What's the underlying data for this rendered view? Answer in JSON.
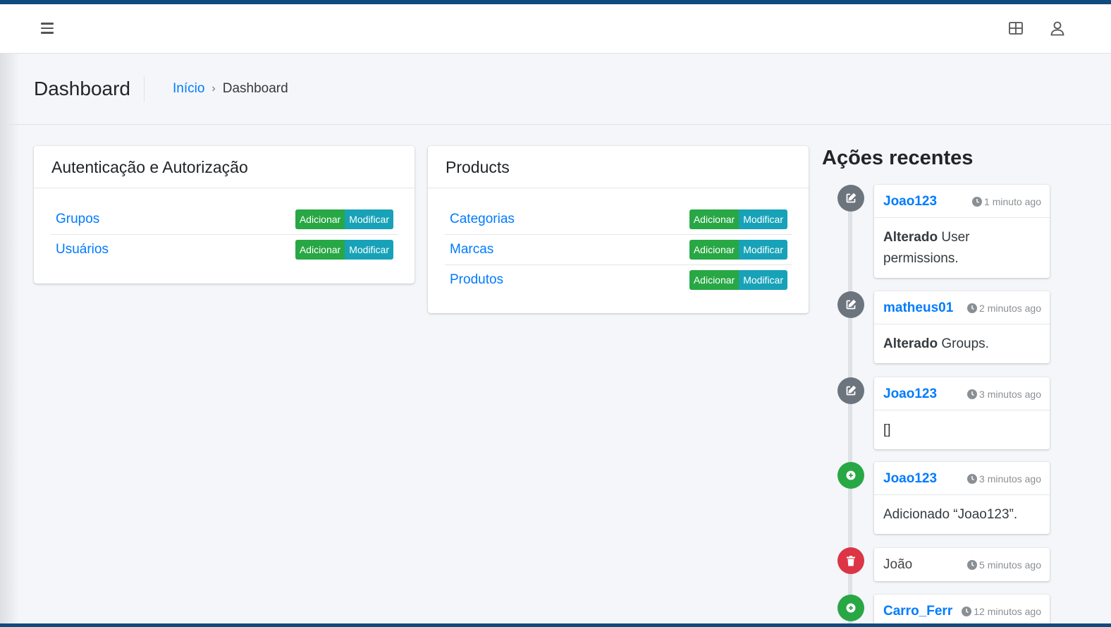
{
  "navbar": {
    "menu_icon": "hamburger-icon",
    "grid_icon": "grid-icon",
    "user_icon": "user-icon"
  },
  "header": {
    "title": "Dashboard",
    "breadcrumb": {
      "home": "Início",
      "separator": "›",
      "current": "Dashboard"
    }
  },
  "apps": [
    {
      "title": "Autenticação e Autorização",
      "models": [
        {
          "name": "Grupos",
          "add": "Adicionar",
          "change": "Modificar"
        },
        {
          "name": "Usuários",
          "add": "Adicionar",
          "change": "Modificar"
        }
      ]
    },
    {
      "title": "Products",
      "models": [
        {
          "name": "Categorias",
          "add": "Adicionar",
          "change": "Modificar"
        },
        {
          "name": "Marcas",
          "add": "Adicionar",
          "change": "Modificar"
        },
        {
          "name": "Produtos",
          "add": "Adicionar",
          "change": "Modificar"
        }
      ]
    }
  ],
  "recent": {
    "title": "Ações recentes",
    "items": [
      {
        "type": "change",
        "icon": "edit-icon",
        "user": "Joao123",
        "time": "1 minuto ago",
        "action": "Alterado",
        "text": " User permissions."
      },
      {
        "type": "change",
        "icon": "edit-icon",
        "user": "matheus01",
        "time": "2 minutos ago",
        "action": "Alterado",
        "text": " Groups."
      },
      {
        "type": "change",
        "icon": "edit-icon",
        "user": "Joao123",
        "time": "3 minutos ago",
        "action": "",
        "text": "[]"
      },
      {
        "type": "add",
        "icon": "plus-circle-icon",
        "user": "Joao123",
        "time": "3 minutos ago",
        "action": "",
        "text": "Adicionado “Joao123”."
      },
      {
        "type": "delete",
        "icon": "trash-icon",
        "user": "João",
        "time": "5 minutos ago"
      },
      {
        "type": "add",
        "icon": "plus-circle-icon",
        "user": "Carro_Ferr",
        "time": "12 minutos ago"
      }
    ]
  },
  "colors": {
    "primary": "#007bff",
    "success": "#28a745",
    "info": "#17a2b8",
    "danger": "#dc3545",
    "secondary": "#6c757d",
    "brand_bar": "#0f4b7c"
  }
}
